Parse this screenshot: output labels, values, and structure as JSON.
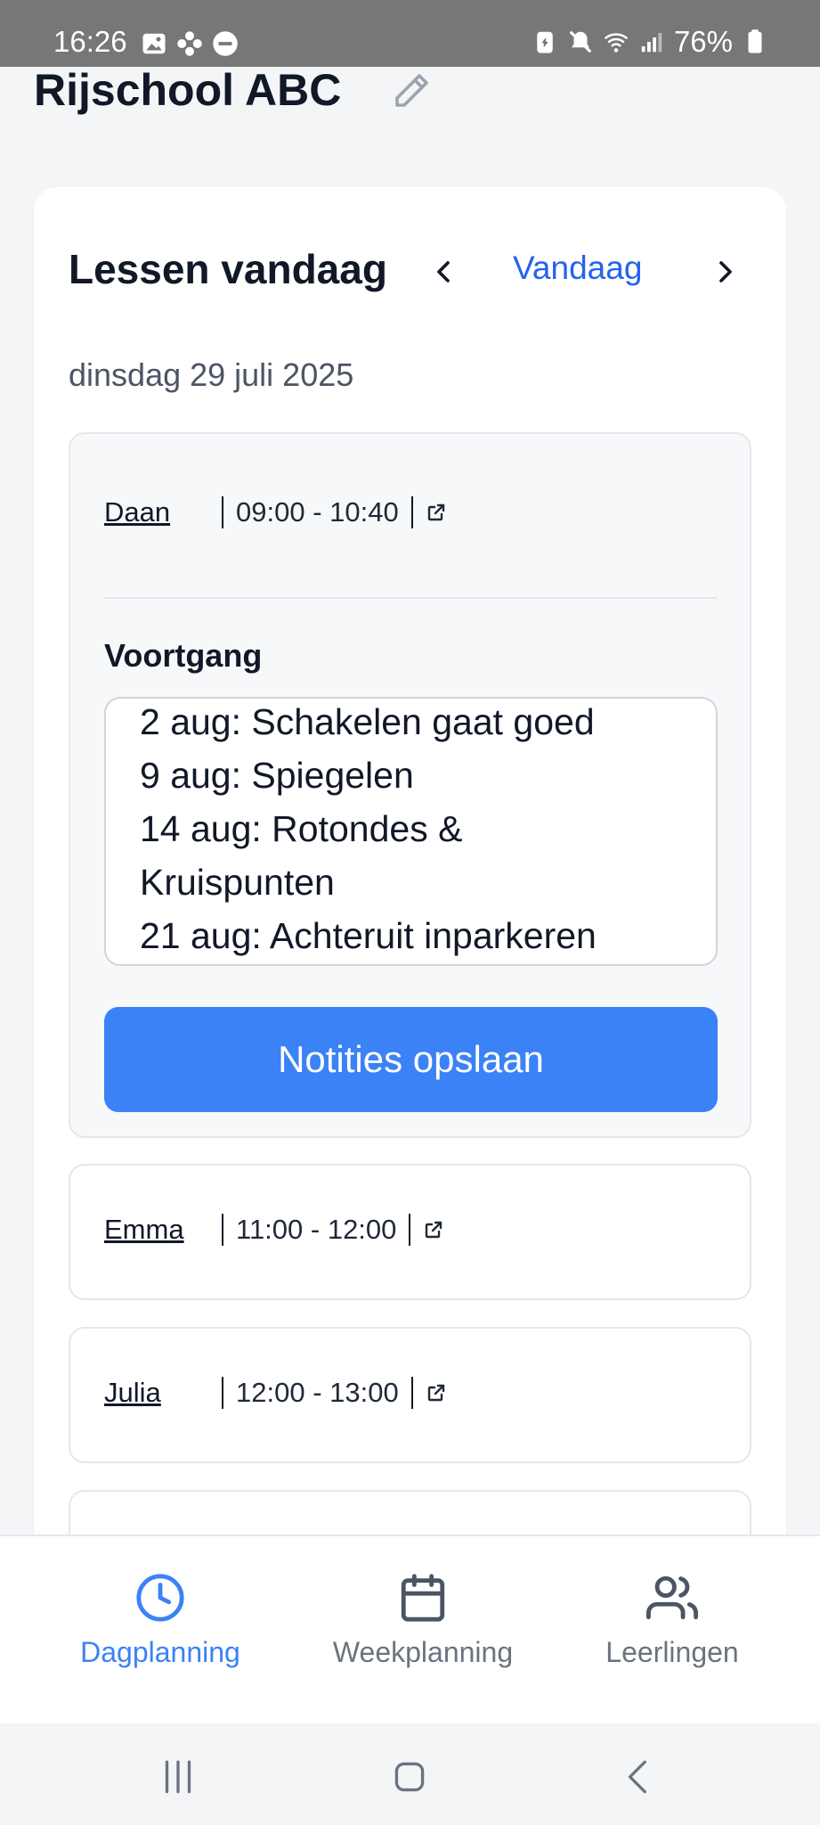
{
  "status_bar": {
    "time": "16:26",
    "battery": "76%",
    "left_icons": [
      "image-icon",
      "flower-icon",
      "dnd-icon"
    ],
    "right_icons": [
      "battery-saver-icon",
      "mute-icon",
      "wifi-icon",
      "signal-icon",
      "battery-icon"
    ]
  },
  "header": {
    "title": "Rijschool ABC"
  },
  "day_card": {
    "title": "Lessen vandaag",
    "today_label": "Vandaag",
    "date": "dinsdag 29 juli 2025"
  },
  "lessons": [
    {
      "student": "Daan",
      "time": "09:00 - 10:40",
      "expanded": true,
      "progress_label": "Voortgang",
      "notes_lines": [
        "2 aug: Schakelen gaat goed",
        "9 aug: Spiegelen",
        "14 aug: Rotondes &",
        "Kruispunten",
        "21 aug: Achteruit inparkeren"
      ],
      "save_label": "Notities opslaan"
    },
    {
      "student": "Emma",
      "time": "11:00 - 12:00",
      "expanded": false
    },
    {
      "student": "Julia",
      "time": "12:00 - 13:00",
      "expanded": false
    }
  ],
  "bottom_nav": {
    "items": [
      {
        "label": "Dagplanning",
        "icon": "clock-icon",
        "active": true
      },
      {
        "label": "Weekplanning",
        "icon": "calendar-icon",
        "active": false
      },
      {
        "label": "Leerlingen",
        "icon": "users-icon",
        "active": false
      }
    ]
  },
  "colors": {
    "accent": "#3b82f6",
    "link": "#2563eb",
    "text": "#111827",
    "muted": "#6b7280",
    "background": "#f4f5f7"
  }
}
